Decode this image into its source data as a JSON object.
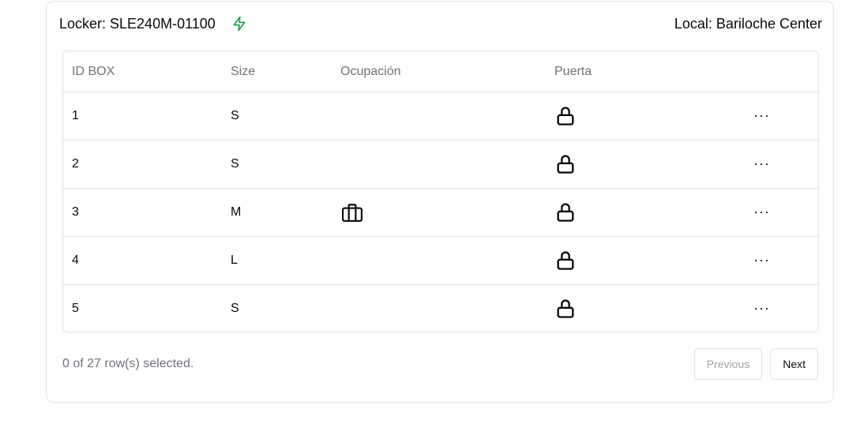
{
  "header": {
    "locker_label": "Locker: SLE240M-01100",
    "local_label": "Local: Bariloche Center",
    "status_icon": "lightning-bolt-icon",
    "status_color": "#16a34a"
  },
  "table": {
    "columns": [
      "ID BOX",
      "Size",
      "Ocupación",
      "Puerta",
      ""
    ],
    "rows": [
      {
        "id": "1",
        "size": "S",
        "occupied": false,
        "door": "lock-icon",
        "actions": "···"
      },
      {
        "id": "2",
        "size": "S",
        "occupied": false,
        "door": "lock-icon",
        "actions": "···"
      },
      {
        "id": "3",
        "size": "M",
        "occupied": true,
        "door": "lock-icon",
        "actions": "···"
      },
      {
        "id": "4",
        "size": "L",
        "occupied": false,
        "door": "lock-icon",
        "actions": "···"
      },
      {
        "id": "5",
        "size": "S",
        "occupied": false,
        "door": "lock-icon",
        "actions": "···"
      }
    ]
  },
  "footer": {
    "selection_text": "0 of 27 row(s) selected.",
    "previous_label": "Previous",
    "next_label": "Next"
  }
}
